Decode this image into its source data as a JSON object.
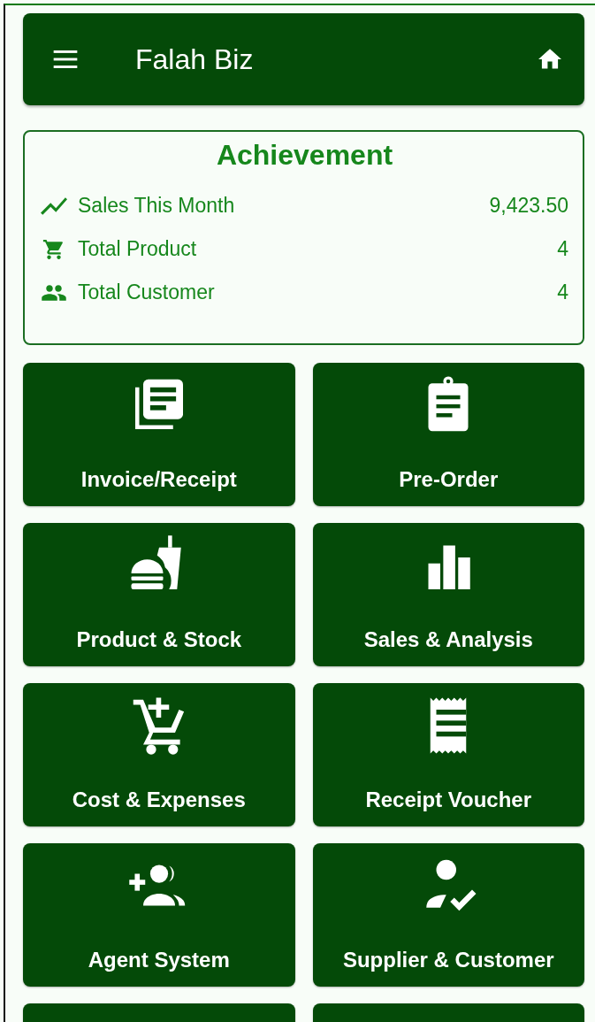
{
  "app_bar": {
    "title": "Falah Biz"
  },
  "achievement": {
    "title": "Achievement",
    "rows": [
      {
        "label": "Sales This Month",
        "value": "9,423.50"
      },
      {
        "label": "Total Product",
        "value": "4"
      },
      {
        "label": "Total Customer",
        "value": "4"
      }
    ]
  },
  "menu_tiles": [
    {
      "label": "Invoice/Receipt"
    },
    {
      "label": "Pre-Order"
    },
    {
      "label": "Product & Stock"
    },
    {
      "label": "Sales & Analysis"
    },
    {
      "label": "Cost & Expenses"
    },
    {
      "label": "Receipt Voucher"
    },
    {
      "label": "Agent System"
    },
    {
      "label": "Supplier & Customer"
    }
  ]
}
